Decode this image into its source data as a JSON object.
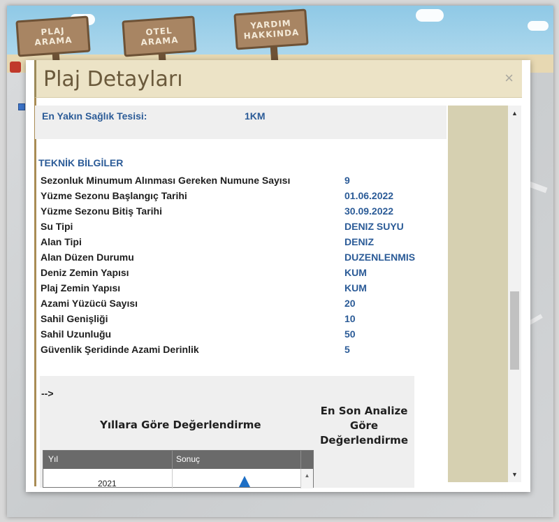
{
  "background": {
    "signs": [
      "PLAJ\nARAMA",
      "OTEL\nARAMA",
      "YARDIM\nHAKKINDA"
    ]
  },
  "modal": {
    "title": "Plaj Detayları",
    "close_symbol": "×",
    "health": {
      "label": "En Yakın Sağlık Tesisi:",
      "value": "1KM"
    },
    "technical": {
      "title": "TEKNİK BİLGİLER",
      "rows": [
        {
          "label": "Sezonluk Minumum Alınması Gereken Numune Sayısı",
          "value": "9"
        },
        {
          "label": "Yüzme Sezonu Başlangıç Tarihi",
          "value": "01.06.2022"
        },
        {
          "label": "Yüzme Sezonu Bitiş Tarihi",
          "value": "30.09.2022"
        },
        {
          "label": "Su Tipi",
          "value": "DENIZ SUYU"
        },
        {
          "label": "Alan Tipi",
          "value": "DENIZ"
        },
        {
          "label": "Alan Düzen Durumu",
          "value": "DUZENLENMIS"
        },
        {
          "label": "Deniz Zemin Yapısı",
          "value": "KUM"
        },
        {
          "label": "Plaj Zemin Yapısı",
          "value": "KUM"
        },
        {
          "label": "Azami Yüzücü Sayısı",
          "value": "20"
        },
        {
          "label": "Sahil Genişliği",
          "value": "10"
        },
        {
          "label": "Sahil Uzunluğu",
          "value": "50"
        },
        {
          "label": "Güvenlik Şeridinde Azami Derinlik",
          "value": "5"
        }
      ]
    },
    "evaluation": {
      "arrow_text": "-->",
      "years_title": "Yıllara Göre Değerlendirme",
      "latest_title": "En Son Analize Göre Değerlendirme",
      "grid": {
        "columns": [
          "Yıl",
          "Sonuç"
        ],
        "rows": [
          {
            "year": "2021"
          }
        ]
      }
    }
  }
}
